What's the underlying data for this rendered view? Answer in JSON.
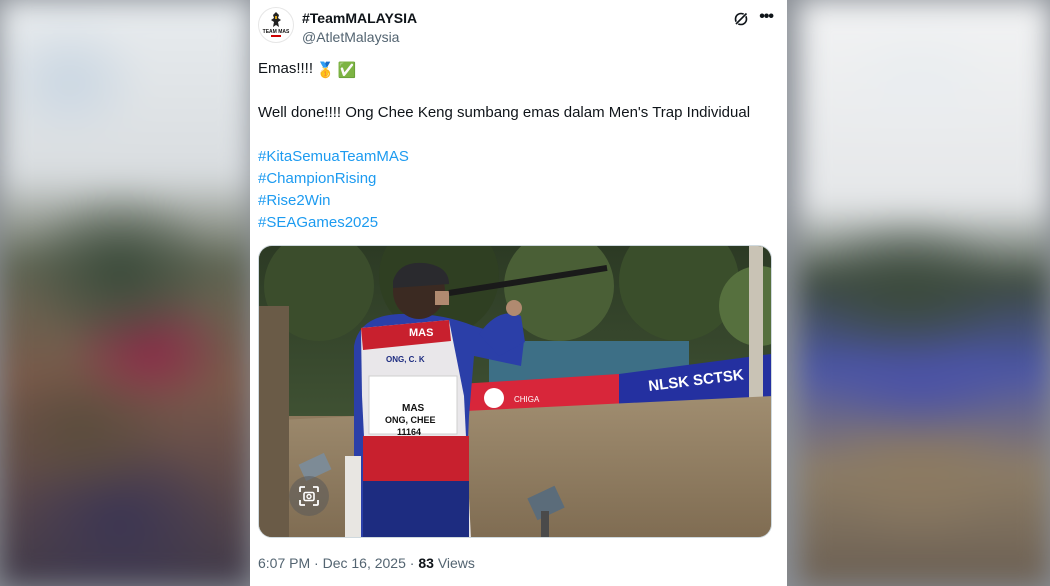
{
  "author": {
    "display_name": "#TeamMALAYSIA",
    "handle": "@AtletMalaysia",
    "avatar_text": "TEAM MAS"
  },
  "icons": {
    "grok": "grok-icon",
    "more": "more-options-icon",
    "scan": "image-scan-icon"
  },
  "tweet": {
    "line1": "Emas!!!!",
    "line1_emojis": [
      "🥇",
      "✅"
    ],
    "line2": "Well done!!!! Ong Chee Keng sumbang  emas dalam Men's Trap Individual",
    "hashtags": [
      "#KitaSemuaTeamMAS",
      "#ChampionRising",
      "#Rise2Win",
      "#SEAGames2025"
    ]
  },
  "photo": {
    "vest_country": "MAS",
    "name_tag": "ONG, C. K",
    "bib_country": "MAS",
    "bib_name": "ONG, CHEE",
    "bib_number": "11164",
    "banner_right": "NLSK SCTSK",
    "banner_left": "CHIGA"
  },
  "meta": {
    "time": "6:07 PM",
    "separator": "·",
    "date": "Dec 16, 2025",
    "views_count": "83",
    "views_label": "Views"
  },
  "colors": {
    "hashtag": "#1d9bf0",
    "text": "#0f1419",
    "secondary": "#536471"
  }
}
